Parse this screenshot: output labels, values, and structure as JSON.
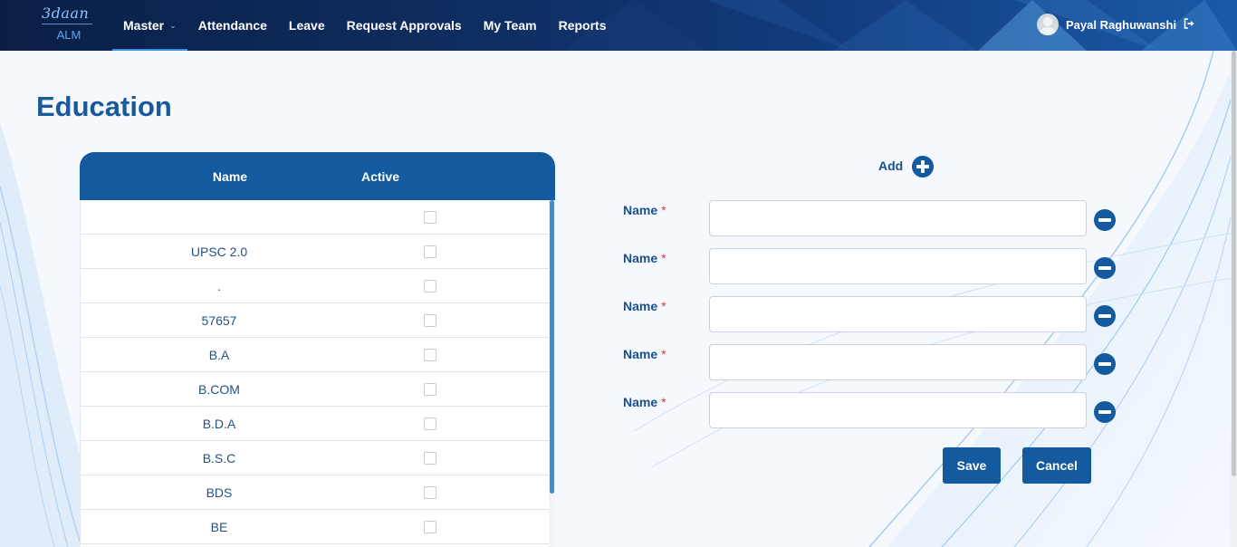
{
  "app": {
    "brand": "3daan",
    "product": "ALM"
  },
  "nav": {
    "items": [
      {
        "label": "Master",
        "has_dropdown": true,
        "active": true
      },
      {
        "label": "Attendance"
      },
      {
        "label": "Leave"
      },
      {
        "label": "Request Approvals"
      },
      {
        "label": "My Team"
      },
      {
        "label": "Reports"
      }
    ]
  },
  "user": {
    "name": "Payal Raghuwanshi",
    "avatar_icon": "user-avatar-icon",
    "logout_icon": "logout-icon"
  },
  "page": {
    "title": "Education"
  },
  "table": {
    "columns": [
      "Name",
      "Active"
    ],
    "rows": [
      {
        "name": "",
        "active": false
      },
      {
        "name": "UPSC 2.0",
        "active": false
      },
      {
        "name": ".",
        "active": false
      },
      {
        "name": "57657",
        "active": false
      },
      {
        "name": "B.A",
        "active": false
      },
      {
        "name": "B.COM",
        "active": false
      },
      {
        "name": "B.D.A",
        "active": false
      },
      {
        "name": "B.S.C",
        "active": false
      },
      {
        "name": "BDS",
        "active": false
      },
      {
        "name": "BE",
        "active": false
      }
    ]
  },
  "form": {
    "add_label": "Add",
    "field_label": "Name",
    "required_mark": "*",
    "fields": [
      {
        "value": ""
      },
      {
        "value": ""
      },
      {
        "value": ""
      },
      {
        "value": ""
      },
      {
        "value": ""
      }
    ],
    "save_label": "Save",
    "cancel_label": "Cancel"
  },
  "colors": {
    "primary": "#135a9e",
    "title": "#1a5a9a",
    "required": "#d9363e",
    "nav_bg": "#0e2c5e"
  }
}
